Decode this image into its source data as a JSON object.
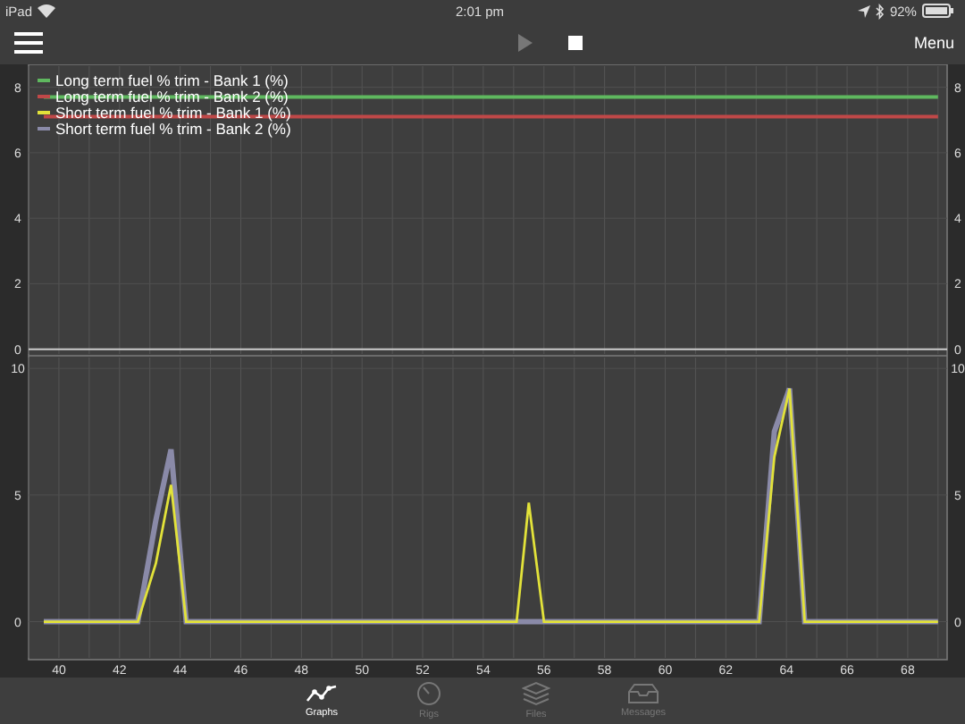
{
  "status_bar": {
    "device": "iPad",
    "time": "2:01 pm",
    "battery": "92%"
  },
  "toolbar": {
    "play_disabled": true,
    "menu_label": "Menu"
  },
  "legend": [
    {
      "label": "Long term fuel % trim - Bank 1 (%)",
      "color": "#5fb85f"
    },
    {
      "label": "Long term fuel % trim - Bank 2 (%)",
      "color": "#c04848"
    },
    {
      "label": "Short term fuel % trim - Bank 1 (%)",
      "color": "#e2e23a"
    },
    {
      "label": "Short term fuel % trim - Bank 2 (%)",
      "color": "#8a8aa8"
    }
  ],
  "charts": [
    {
      "left_axis_labels": [
        "8",
        "6",
        "4",
        "2",
        "0"
      ],
      "right_axis_labels": [
        "8",
        "6",
        "4",
        "2",
        "0"
      ],
      "chart_data": {
        "type": "line",
        "grid": true,
        "x": [
          39.5,
          69
        ],
        "xlim": [
          39,
          69.3
        ],
        "ylim": [
          -0.2,
          8.7
        ],
        "yticks": [
          0,
          2,
          4,
          6,
          8
        ],
        "series": [
          {
            "color": "#5fb85f",
            "values": [
              7.7,
              7.7
            ]
          },
          {
            "color": "#c04848",
            "values": [
              7.1,
              7.1
            ]
          }
        ]
      }
    },
    {
      "left_axis_labels": [
        "10",
        "5",
        "0"
      ],
      "right_axis_labels": [
        "10",
        "5",
        "0"
      ],
      "chart_data": {
        "type": "line",
        "grid": true,
        "x": [
          39.5,
          42.6,
          43.2,
          43.7,
          44.2,
          55.1,
          55.5,
          56.0,
          63.1,
          63.6,
          64.1,
          64.6,
          69
        ],
        "xlim": [
          39,
          69.3
        ],
        "ylim": [
          -1.5,
          10.5
        ],
        "yticks": [
          0,
          5,
          10
        ],
        "xticks": [
          40,
          42,
          44,
          46,
          48,
          50,
          52,
          54,
          56,
          58,
          60,
          62,
          64,
          66,
          68
        ],
        "series": [
          {
            "color": "#8a8aa8",
            "values": [
              0,
              0,
              4,
              6.8,
              0,
              0,
              0,
              0,
              0,
              7.5,
              9.2,
              0,
              0
            ]
          },
          {
            "color": "#e2e23a",
            "values": [
              0,
              0,
              2.3,
              5.4,
              0,
              0,
              4.7,
              0,
              0,
              6.5,
              9.2,
              0,
              0
            ]
          }
        ]
      }
    }
  ],
  "tabs": [
    {
      "label": "Graphs",
      "selected": true,
      "kind": "graph"
    },
    {
      "label": "Rigs",
      "selected": false,
      "kind": "gauge"
    },
    {
      "label": "Files",
      "selected": false,
      "kind": "layers"
    },
    {
      "label": "Messages",
      "selected": false,
      "kind": "inbox"
    }
  ]
}
